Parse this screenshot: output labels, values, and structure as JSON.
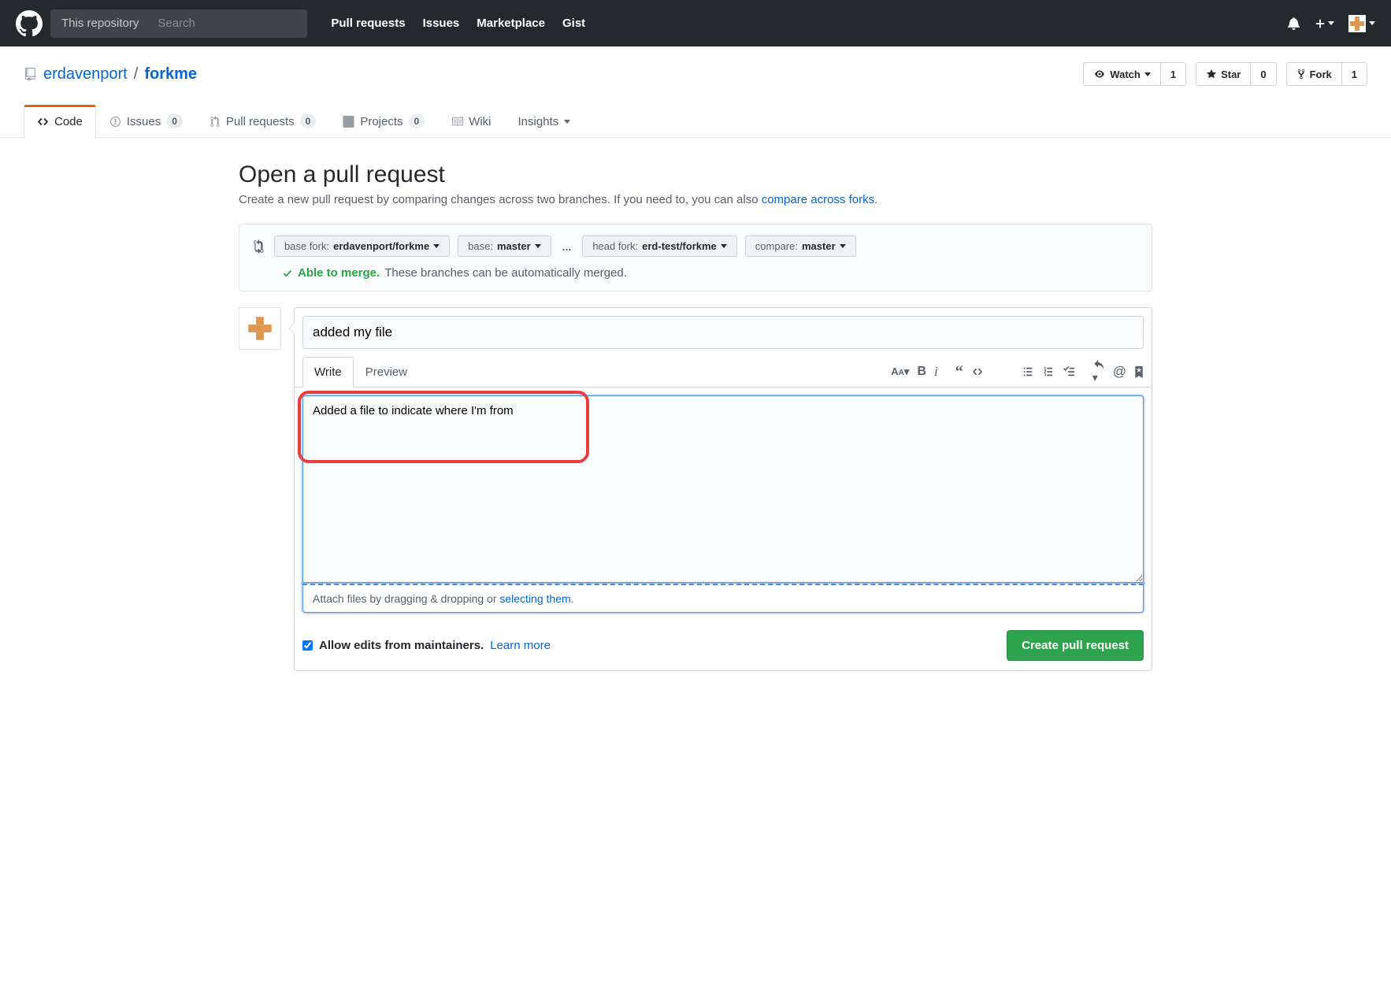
{
  "header": {
    "search_scope": "This repository",
    "search_placeholder": "Search",
    "nav": [
      "Pull requests",
      "Issues",
      "Marketplace",
      "Gist"
    ]
  },
  "repo": {
    "owner": "erdavenport",
    "name": "forkme",
    "actions": {
      "watch": {
        "label": "Watch",
        "count": "1"
      },
      "star": {
        "label": "Star",
        "count": "0"
      },
      "fork": {
        "label": "Fork",
        "count": "1"
      }
    }
  },
  "tabs": {
    "code": "Code",
    "issues": {
      "label": "Issues",
      "count": "0"
    },
    "pulls": {
      "label": "Pull requests",
      "count": "0"
    },
    "projects": {
      "label": "Projects",
      "count": "0"
    },
    "wiki": "Wiki",
    "insights": "Insights"
  },
  "page": {
    "title": "Open a pull request",
    "subtitle_pre": "Create a new pull request by comparing changes across two branches. If you need to, you can also ",
    "subtitle_link": "compare across forks",
    "subtitle_post": "."
  },
  "compare": {
    "base_fork": {
      "label": "base fork:",
      "value": "erdavenport/forkme"
    },
    "base": {
      "label": "base:",
      "value": "master"
    },
    "head_fork": {
      "label": "head fork:",
      "value": "erd-test/forkme"
    },
    "compare_branch": {
      "label": "compare:",
      "value": "master"
    },
    "merge_status": "Able to merge.",
    "merge_detail": "These branches can be automatically merged."
  },
  "form": {
    "title_value": "added my file",
    "write_tab": "Write",
    "preview_tab": "Preview",
    "body_value": "Added a file to indicate where I'm from",
    "attach_pre": "Attach files by dragging & dropping or ",
    "attach_link": "selecting them",
    "attach_post": ".",
    "allow_edits": "Allow edits from maintainers.",
    "learn_more": "Learn more",
    "submit": "Create pull request"
  }
}
